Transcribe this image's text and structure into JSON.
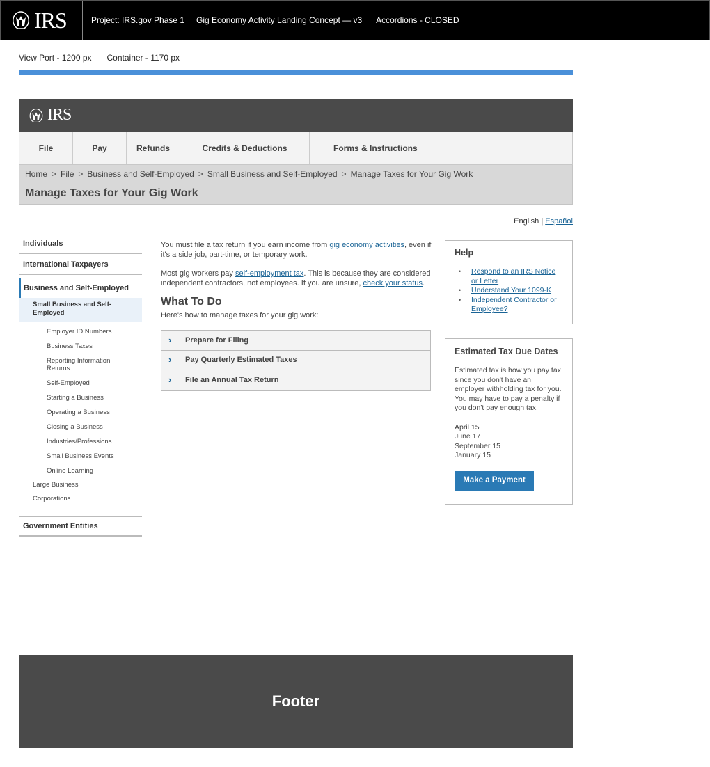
{
  "annotation_bar": {
    "logo_text": "IRS",
    "project": "Project: IRS.gov Phase 1",
    "concept": "Gig Economy Activity Landing Concept — v3",
    "state": "Accordions - CLOSED"
  },
  "meta": {
    "viewport": "View Port - 1200 px",
    "container": "Container - 1170 px"
  },
  "colors": {
    "accent_bar": "#4a90d9",
    "link": "#1a6496",
    "button": "#2a7ab5",
    "header_bg": "#4a4a4a"
  },
  "header": {
    "logo_text": "IRS"
  },
  "nav": {
    "items": [
      {
        "label": "File"
      },
      {
        "label": "Pay"
      },
      {
        "label": "Refunds"
      },
      {
        "label": "Credits & Deductions"
      },
      {
        "label": "Forms & Instructions"
      }
    ]
  },
  "breadcrumb": {
    "items": [
      "Home",
      "File",
      "Business and Self-Employed",
      "Small Business and Self-Employed",
      "Manage Taxes for Your Gig Work"
    ],
    "separator": ">"
  },
  "page_title": "Manage Taxes for Your Gig Work",
  "language": {
    "current": "English",
    "divider": "|",
    "alternate": "Español"
  },
  "sidebar": {
    "top_items": [
      "Individuals",
      "International Taxpayers"
    ],
    "active": "Business and Self-Employed",
    "sub_active": "Small Business and Self-Employed",
    "sub_sub_items": [
      "Employer ID Numbers",
      "Business Taxes",
      "Reporting Information Returns",
      "Self-Employed",
      "Starting a Business",
      "Operating a Business",
      "Closing a Business",
      "Industries/Professions",
      "Small Business Events",
      "Online Learning"
    ],
    "sub_items": [
      "Large Business",
      "Corporations"
    ],
    "bottom_item": "Government Entities"
  },
  "main": {
    "p1_before": "You must file a tax return if you earn income from ",
    "p1_link": "gig economy activities",
    "p1_after": ", even if it's a side job, part-time, or temporary work.",
    "p2_before": "Most gig workers pay ",
    "p2_link1": "self-employment tax",
    "p2_middle": ". This is because they are considered independent contractors, not employees. If you are unsure, ",
    "p2_link2": "check your status",
    "p2_after": ".",
    "heading": "What To Do",
    "intro": "Here's how to manage taxes for your gig work:",
    "accordion": [
      {
        "label": "Prepare for Filing",
        "expanded": false
      },
      {
        "label": "Pay Quarterly Estimated Taxes",
        "expanded": false
      },
      {
        "label": "File an Annual Tax Return",
        "expanded": false
      }
    ]
  },
  "help": {
    "title": "Help",
    "links": [
      "Respond to an IRS Notice or Letter",
      "Understand Your 1099-K",
      "Independent Contractor or Employee?"
    ]
  },
  "due_dates": {
    "title": "Estimated Tax Due Dates",
    "body": "Estimated tax is how you pay tax since you don't have an employer withholding tax for you. You may have to pay a penalty if you don't pay enough tax.",
    "dates": [
      "April 15",
      "June 17",
      "September 15",
      "January 15"
    ],
    "button": "Make a Payment"
  },
  "footer": {
    "label": "Footer"
  }
}
